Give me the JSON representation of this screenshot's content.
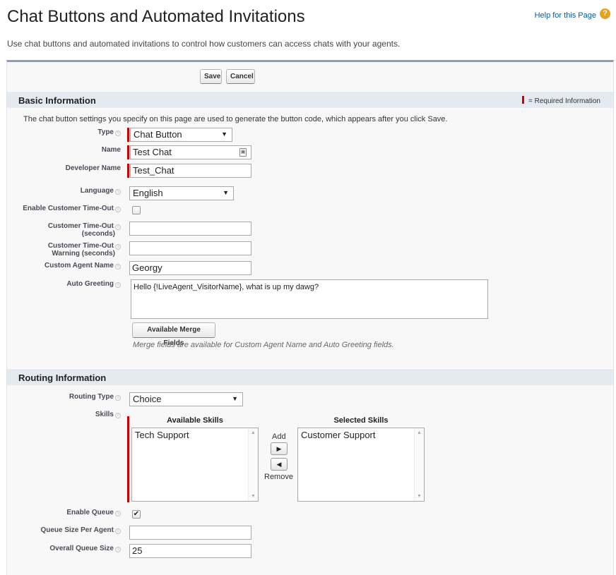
{
  "header": {
    "title": "Chat Buttons and Automated Invitations",
    "help_link": "Help for this Page",
    "help_icon": "?",
    "subtitle": "Use chat buttons and automated invitations to control how customers can access chats with your agents."
  },
  "toolbar": {
    "save_label": "Save",
    "cancel_label": "Cancel"
  },
  "basic": {
    "section_title": "Basic Information",
    "required_legend": "= Required Information",
    "intro": "The chat button settings you specify on this page are used to generate the button code, which appears after you click Save.",
    "type_label": "Type",
    "type_value": "Chat Button",
    "name_label": "Name",
    "name_value": "Test Chat",
    "dev_name_label": "Developer Name",
    "dev_name_value": "Test_Chat",
    "language_label": "Language",
    "language_value": "English",
    "timeout_enable_label": "Enable Customer Time-Out",
    "timeout_label_1": "Customer Time-Out",
    "timeout_label_2": "(seconds)",
    "timeout_warning_label_1": "Customer Time-Out",
    "timeout_warning_label_2": "Warning (seconds)",
    "agent_name_label": "Custom Agent Name",
    "agent_name_value": "Georgy",
    "auto_greeting_label": "Auto Greeting",
    "auto_greeting_value": "Hello {!LiveAgent_VisitorName}, what is up my dawg?",
    "merge_fields_button": "Available Merge Fields",
    "merge_hint": "Merge fields are available for Custom Agent Name and Auto Greeting fields."
  },
  "routing": {
    "section_title": "Routing Information",
    "routing_type_label": "Routing Type",
    "routing_type_value": "Choice",
    "skills_label": "Skills",
    "available_header": "Available Skills",
    "selected_header": "Selected Skills",
    "available_items": [
      "Tech Support"
    ],
    "selected_items": [
      "Customer Support"
    ],
    "add_label": "Add",
    "remove_label": "Remove",
    "enable_queue_label": "Enable Queue",
    "enable_queue_checked": "✔",
    "queue_size_label": "Queue Size Per Agent",
    "queue_size_value": "",
    "overall_queue_label": "Overall Queue Size",
    "overall_queue_value": "25"
  },
  "colors": {
    "required": "#cc0000",
    "section_bar": "#e5eaf0",
    "panel_border": "#8a9ebe",
    "help_icon": "#e8a21b"
  }
}
